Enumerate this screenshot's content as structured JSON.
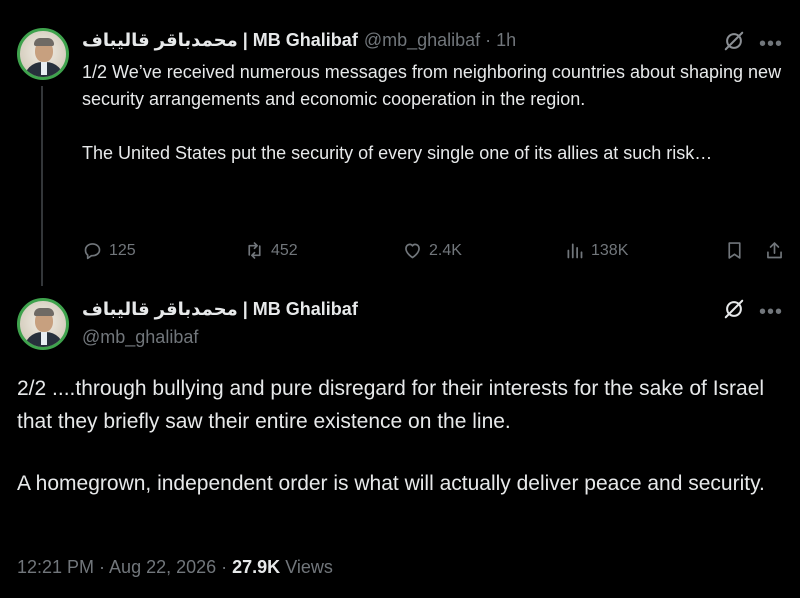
{
  "tweet1": {
    "author_name": "محمدباقر قالیباف | MB Ghalibaf",
    "handle": "@mb_ghalibaf",
    "separator": "·",
    "time": "1h",
    "paragraphs": [
      "1/2 We’ve received numerous messages from neighboring countries about shaping new security arrangements and economic cooperation in the region.",
      "The United States put the security of every single one of its allies at such risk…"
    ],
    "replies": "125",
    "reposts": "452",
    "likes": "2.4K",
    "views": "138K"
  },
  "tweet2": {
    "author_name": "محمدباقر قالیباف | MB Ghalibaf",
    "handle": "@mb_ghalibaf",
    "paragraphs": [
      "2/2 ....through bullying and pure disregard for their interests for the sake of Israel that they briefly saw their entire existence on the line.",
      "A homegrown, independent order is what will actually deliver peace and security."
    ],
    "timestamp": "12:21 PM · Aug 22, 2026 · ",
    "views_count": "27.9K",
    "views_label": " Views"
  },
  "icons": {
    "more": "more-horizontal-icon",
    "grok": "grok-icon",
    "reply": "reply-icon",
    "repost": "repost-icon",
    "like": "heart-icon",
    "views": "views-bar-chart-icon",
    "bookmark": "bookmark-icon",
    "share": "share-icon"
  },
  "colors": {
    "background": "#000000",
    "text_primary": "#e7e9ea",
    "text_secondary": "#71767b",
    "thread_line": "#333639",
    "avatar_ring": "#3fa34d"
  }
}
